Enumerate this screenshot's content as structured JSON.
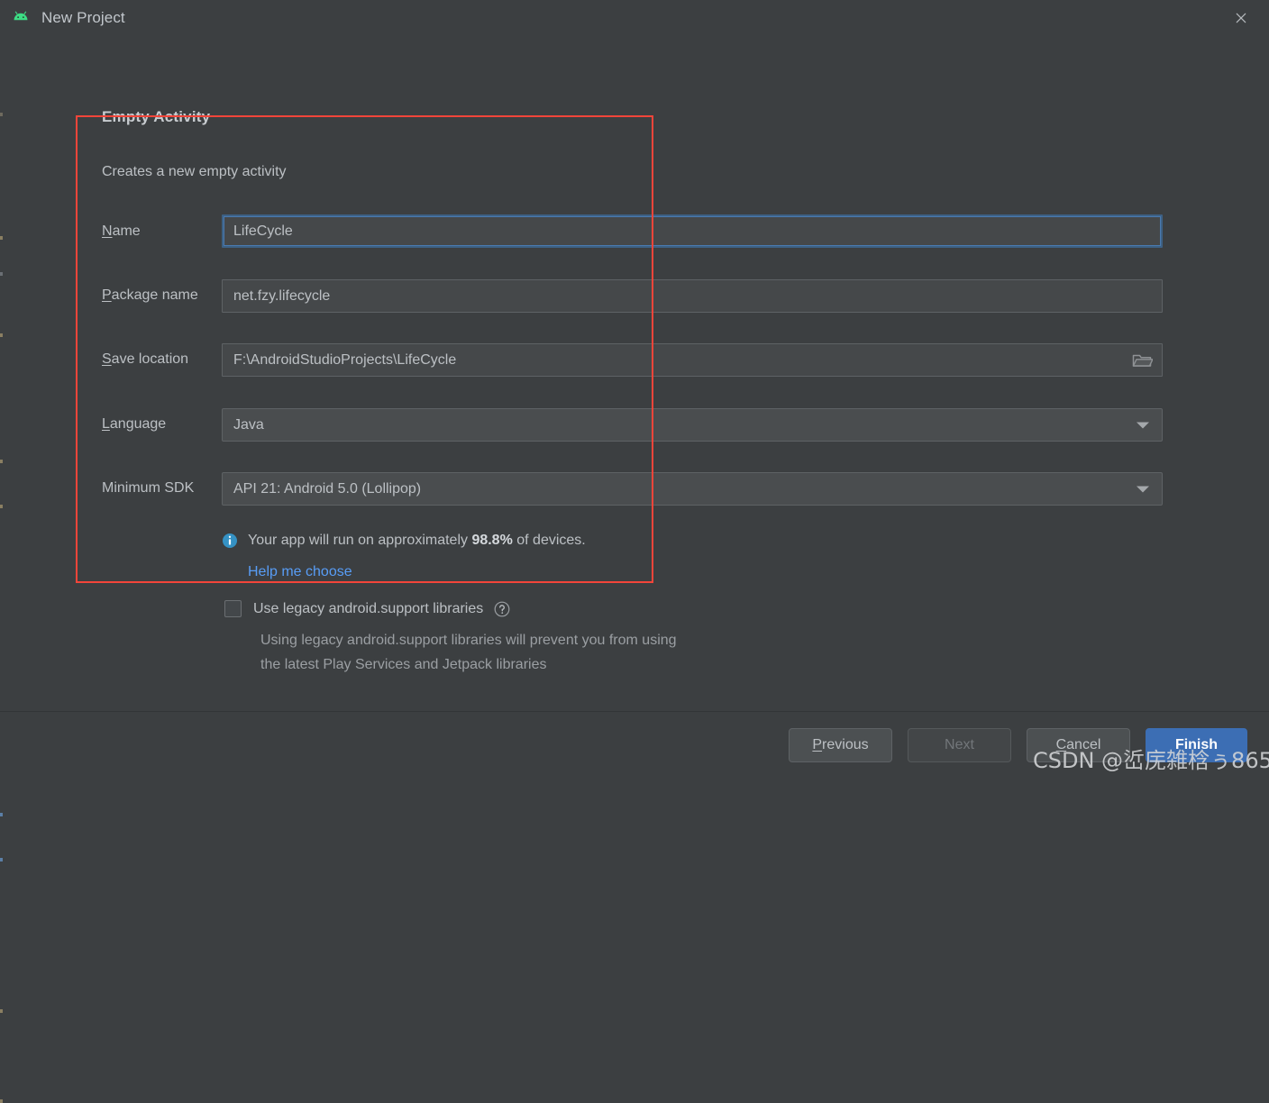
{
  "window": {
    "title": "New Project",
    "app_icon": "android-robot-icon",
    "close_icon": "close-icon"
  },
  "section": {
    "title": "Empty Activity",
    "description": "Creates a new empty activity"
  },
  "form": {
    "rows": [
      {
        "label_prefix": "",
        "label_mnemonic": "N",
        "label_suffix": "ame",
        "value": "LifeCycle",
        "type": "text",
        "focused": true
      },
      {
        "label_prefix": "",
        "label_mnemonic": "P",
        "label_suffix": "ackage name",
        "value": "net.fzy.lifecycle",
        "type": "text",
        "focused": false
      },
      {
        "label_prefix": "",
        "label_mnemonic": "S",
        "label_suffix": "ave location",
        "value": "F:\\AndroidStudioProjects\\LifeCycle",
        "type": "path",
        "focused": false,
        "trailing_icon": "folder-icon"
      },
      {
        "label_prefix": "",
        "label_mnemonic": "L",
        "label_suffix": "anguage",
        "value": "Java",
        "type": "combo",
        "focused": false
      },
      {
        "label_prefix": "Minimum SDK",
        "label_mnemonic": "",
        "label_suffix": "",
        "value": "API 21: Android 5.0 (Lollipop)",
        "type": "combo",
        "focused": false
      }
    ]
  },
  "info": {
    "icon": "info-icon",
    "text_before": "Your app will run on approximately ",
    "percent": "98.8%",
    "text_after": " of devices.",
    "link": "Help me choose"
  },
  "legacy": {
    "checkbox_label": "Use legacy android.support libraries",
    "checked": false,
    "help_icon": "question-mark-icon",
    "description_line1": "Using legacy android.support libraries will prevent you from using",
    "description_line2": "the latest Play Services and Jetpack libraries"
  },
  "footer": {
    "buttons": [
      {
        "prefix": "",
        "mnemonic": "P",
        "suffix": "revious",
        "state": "enabled"
      },
      {
        "prefix": "Next",
        "mnemonic": "",
        "suffix": "",
        "state": "disabled"
      },
      {
        "prefix": "",
        "mnemonic": "C",
        "suffix": "ancel",
        "state": "enabled"
      },
      {
        "prefix": "",
        "mnemonic": "",
        "suffix": "Finish",
        "state": "primary"
      }
    ]
  },
  "watermark": {
    "text": "CSDN @峾庑雑梒ぅ865"
  },
  "colors": {
    "window_background": "#3c3f41",
    "field_background": "#45484a",
    "field_border": "#5e6265",
    "focus_border": "#4a7ab0",
    "accent_link": "#589df6",
    "primary_button": "#3c6eb4",
    "annotation_red": "#f3453a",
    "android_green": "#3ddc84"
  }
}
